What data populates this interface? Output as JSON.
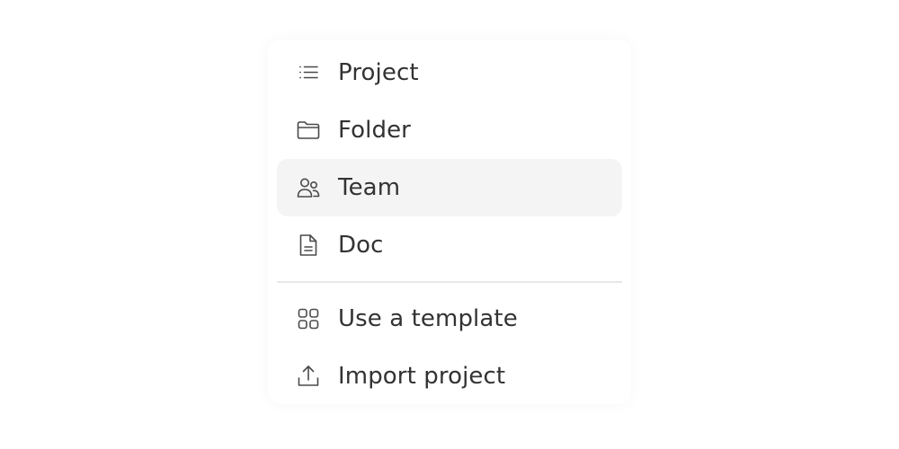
{
  "menu": {
    "items": [
      {
        "label": "Project",
        "icon": "list-icon",
        "active": false
      },
      {
        "label": "Folder",
        "icon": "folder-icon",
        "active": false
      },
      {
        "label": "Team",
        "icon": "team-icon",
        "active": true
      },
      {
        "label": "Doc",
        "icon": "document-icon",
        "active": false
      }
    ],
    "secondary_items": [
      {
        "label": "Use a template",
        "icon": "template-grid-icon"
      },
      {
        "label": "Import project",
        "icon": "upload-icon"
      }
    ]
  },
  "colors": {
    "text": "#333333",
    "icon": "#4a4a4a",
    "hover_bg": "#f4f4f4",
    "divider": "#e8e8e8"
  }
}
